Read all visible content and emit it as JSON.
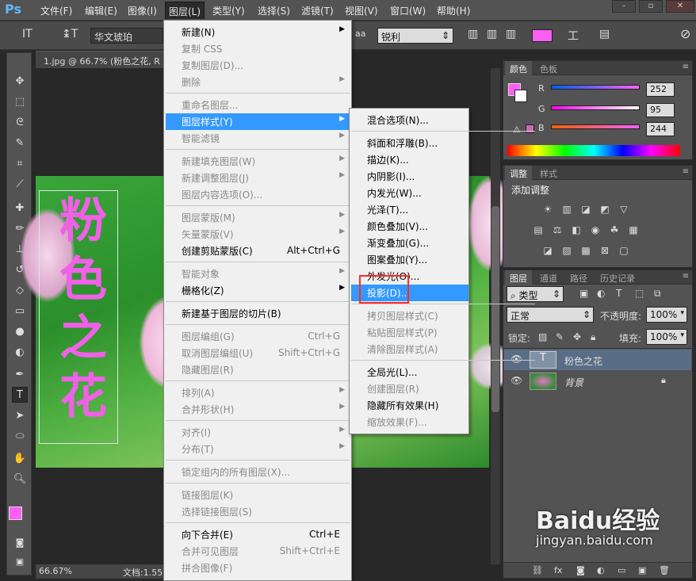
{
  "menubar": {
    "logo": "Ps",
    "items": [
      "文件(F)",
      "编辑(E)",
      "图像(I)",
      "图层(L)",
      "类型(Y)",
      "选择(S)",
      "滤镜(T)",
      "视图(V)",
      "窗口(W)",
      "帮助(H)"
    ],
    "active_index": 3
  },
  "options": {
    "font_family": "华文琥珀",
    "aa_label": "aa",
    "aa_mode": "锐利",
    "text_color": "#fc5ff4"
  },
  "document": {
    "tab_title": "1.jpg @ 66.7% (粉色之花, R",
    "zoom": "66.67%",
    "status": "文档:1.55",
    "text": [
      "粉",
      "色",
      "之",
      "花"
    ]
  },
  "layer_menu": {
    "items": [
      {
        "label": "新建(N)",
        "shortcut": "",
        "arrow": true,
        "disabled": false
      },
      {
        "label": "复制 CSS",
        "shortcut": "",
        "arrow": false,
        "disabled": true
      },
      {
        "label": "复制图层(D)...",
        "shortcut": "",
        "arrow": false,
        "disabled": true
      },
      {
        "label": "删除",
        "shortcut": "",
        "arrow": true,
        "disabled": true
      },
      {
        "sep": true
      },
      {
        "label": "重命名图层...",
        "shortcut": "",
        "arrow": false,
        "disabled": true
      },
      {
        "label": "图层样式(Y)",
        "shortcut": "",
        "arrow": true,
        "disabled": false,
        "highlight": true
      },
      {
        "label": "智能滤镜",
        "shortcut": "",
        "arrow": true,
        "disabled": true
      },
      {
        "sep": true
      },
      {
        "label": "新建填充图层(W)",
        "shortcut": "",
        "arrow": true,
        "disabled": true
      },
      {
        "label": "新建调整图层(J)",
        "shortcut": "",
        "arrow": true,
        "disabled": true
      },
      {
        "label": "图层内容选项(O)...",
        "shortcut": "",
        "arrow": false,
        "disabled": true
      },
      {
        "sep": true
      },
      {
        "label": "图层蒙版(M)",
        "shortcut": "",
        "arrow": true,
        "disabled": true
      },
      {
        "label": "矢量蒙版(V)",
        "shortcut": "",
        "arrow": true,
        "disabled": true
      },
      {
        "label": "创建剪贴蒙版(C)",
        "shortcut": "Alt+Ctrl+G",
        "arrow": false,
        "disabled": false
      },
      {
        "sep": true
      },
      {
        "label": "智能对象",
        "shortcut": "",
        "arrow": true,
        "disabled": true
      },
      {
        "label": "栅格化(Z)",
        "shortcut": "",
        "arrow": true,
        "disabled": false
      },
      {
        "sep": true
      },
      {
        "label": "新建基于图层的切片(B)",
        "shortcut": "",
        "arrow": false,
        "disabled": false
      },
      {
        "sep": true
      },
      {
        "label": "图层编组(G)",
        "shortcut": "Ctrl+G",
        "arrow": false,
        "disabled": true
      },
      {
        "label": "取消图层编组(U)",
        "shortcut": "Shift+Ctrl+G",
        "arrow": false,
        "disabled": true
      },
      {
        "label": "隐藏图层(R)",
        "shortcut": "",
        "arrow": false,
        "disabled": true
      },
      {
        "sep": true
      },
      {
        "label": "排列(A)",
        "shortcut": "",
        "arrow": true,
        "disabled": true
      },
      {
        "label": "合并形状(H)",
        "shortcut": "",
        "arrow": true,
        "disabled": true
      },
      {
        "sep": true
      },
      {
        "label": "对齐(I)",
        "shortcut": "",
        "arrow": true,
        "disabled": true
      },
      {
        "label": "分布(T)",
        "shortcut": "",
        "arrow": true,
        "disabled": true
      },
      {
        "sep": true
      },
      {
        "label": "锁定组内的所有图层(X)...",
        "shortcut": "",
        "arrow": false,
        "disabled": true
      },
      {
        "sep": true
      },
      {
        "label": "链接图层(K)",
        "shortcut": "",
        "arrow": false,
        "disabled": true
      },
      {
        "label": "选择链接图层(S)",
        "shortcut": "",
        "arrow": false,
        "disabled": true
      },
      {
        "sep": true
      },
      {
        "label": "向下合并(E)",
        "shortcut": "Ctrl+E",
        "arrow": false,
        "disabled": false
      },
      {
        "label": "合并可见图层",
        "shortcut": "Shift+Ctrl+E",
        "arrow": false,
        "disabled": true
      },
      {
        "label": "拼合图像(F)",
        "shortcut": "",
        "arrow": false,
        "disabled": true
      }
    ]
  },
  "style_submenu": {
    "items": [
      {
        "label": "混合选项(N)...",
        "disabled": false
      },
      {
        "sep": true
      },
      {
        "label": "斜面和浮雕(B)...",
        "disabled": false
      },
      {
        "label": "描边(K)...",
        "disabled": false
      },
      {
        "label": "内阴影(I)...",
        "disabled": false
      },
      {
        "label": "内发光(W)...",
        "disabled": false
      },
      {
        "label": "光泽(T)...",
        "disabled": false
      },
      {
        "label": "颜色叠加(V)...",
        "disabled": false
      },
      {
        "label": "渐变叠加(G)...",
        "disabled": false
      },
      {
        "label": "图案叠加(Y)...",
        "disabled": false
      },
      {
        "label": "外发光(O)...",
        "disabled": false
      },
      {
        "label": "投影(D)...",
        "disabled": false,
        "highlight": true
      },
      {
        "sep": true
      },
      {
        "label": "拷贝图层样式(C)",
        "disabled": true
      },
      {
        "label": "粘贴图层样式(P)",
        "disabled": true
      },
      {
        "label": "清除图层样式(A)",
        "disabled": true
      },
      {
        "sep": true
      },
      {
        "label": "全局光(L)...",
        "disabled": false
      },
      {
        "label": "创建图层(R)",
        "disabled": true
      },
      {
        "label": "隐藏所有效果(H)",
        "disabled": false
      },
      {
        "label": "缩放效果(F)...",
        "disabled": true
      }
    ]
  },
  "color_panel": {
    "tabs": [
      "颜色",
      "色板"
    ],
    "r_label": "R",
    "g_label": "G",
    "b_label": "B",
    "r": "252",
    "g": "95",
    "b": "244",
    "fg": "#fc5ff4"
  },
  "adjust_panel": {
    "tabs": [
      "调整",
      "样式"
    ],
    "title": "添加调整"
  },
  "layers_panel": {
    "tabs": [
      "图层",
      "通道",
      "路径",
      "历史记录"
    ],
    "filter": "类型",
    "blend": "正常",
    "opacity_label": "不透明度:",
    "opacity": "100%",
    "lock_label": "锁定:",
    "fill_label": "填充:",
    "fill": "100%",
    "layers": [
      {
        "name": "粉色之花",
        "type": "text",
        "selected": true
      },
      {
        "name": "背景",
        "type": "image",
        "selected": false
      }
    ]
  },
  "watermark": {
    "brand": "Baidu经验",
    "url": "jingyan.baidu.com"
  }
}
